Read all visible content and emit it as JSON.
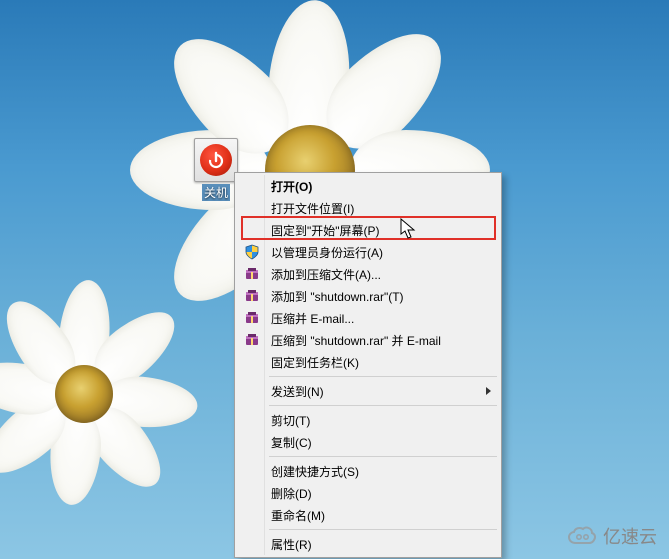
{
  "wallpaper": {
    "style": "blue-sky-with-daisies",
    "primary_color": "#4a9ad0"
  },
  "desktop_icon": {
    "app": "shutdown",
    "caption": "关机",
    "accent": "#e03018"
  },
  "context_menu": {
    "highlighted_index": 2,
    "items": [
      {
        "label": "打开(O)",
        "bold": true
      },
      {
        "label": "打开文件位置(I)"
      },
      {
        "label": "固定到\"开始\"屏幕(P)",
        "highlighted": true
      },
      {
        "label": "以管理员身份运行(A)",
        "icon": "shield"
      },
      {
        "label": "添加到压缩文件(A)...",
        "icon": "rar"
      },
      {
        "label": "添加到 \"shutdown.rar\"(T)",
        "icon": "rar"
      },
      {
        "label": "压缩并 E-mail...",
        "icon": "rar"
      },
      {
        "label": "压缩到 \"shutdown.rar\" 并 E-mail",
        "icon": "rar"
      },
      {
        "label": "固定到任务栏(K)"
      },
      {
        "separator": true
      },
      {
        "label": "发送到(N)",
        "submenu": true
      },
      {
        "separator": true
      },
      {
        "label": "剪切(T)"
      },
      {
        "label": "复制(C)"
      },
      {
        "separator": true
      },
      {
        "label": "创建快捷方式(S)"
      },
      {
        "label": "删除(D)"
      },
      {
        "label": "重命名(M)"
      },
      {
        "separator": true
      },
      {
        "label": "属性(R)"
      }
    ]
  },
  "watermark": {
    "text": "亿速云"
  }
}
